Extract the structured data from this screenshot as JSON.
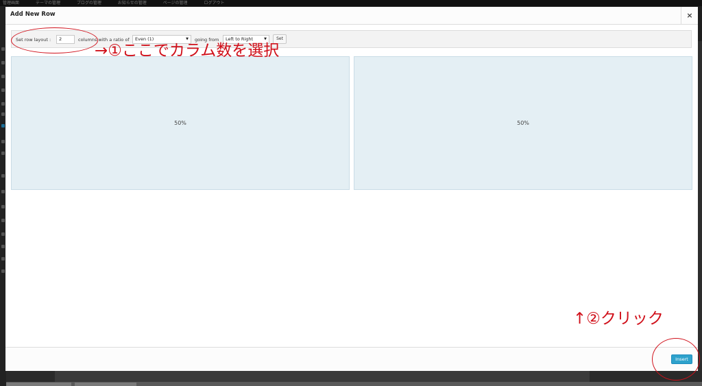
{
  "admin_bar": {
    "items": [
      "管理画面",
      "テーマの管理",
      "ブログの管理",
      "お知らせの管理",
      "ページの管理",
      "ログアウト"
    ]
  },
  "modal": {
    "title": "Add New Row",
    "close_label": "×",
    "toolbar": {
      "set_row_layout_label": "Set row layout :",
      "columns_value": "2",
      "columns_with_ratio_label": "columns with a ratio of",
      "ratio_selected": "Even (1)",
      "going_from_label": "going from",
      "direction_selected": "Left to Right",
      "set_button_label": "Set"
    },
    "columns": [
      {
        "label": "50%"
      },
      {
        "label": "50%"
      }
    ],
    "footer": {
      "insert_label": "Insert"
    }
  },
  "annotations": {
    "step1": "→①ここでカラム数を選択",
    "step2": "↑②クリック",
    "color": "#d0101a"
  },
  "colors": {
    "column_bg": "#e4eff4",
    "insert_button": "#2ea2cc"
  }
}
